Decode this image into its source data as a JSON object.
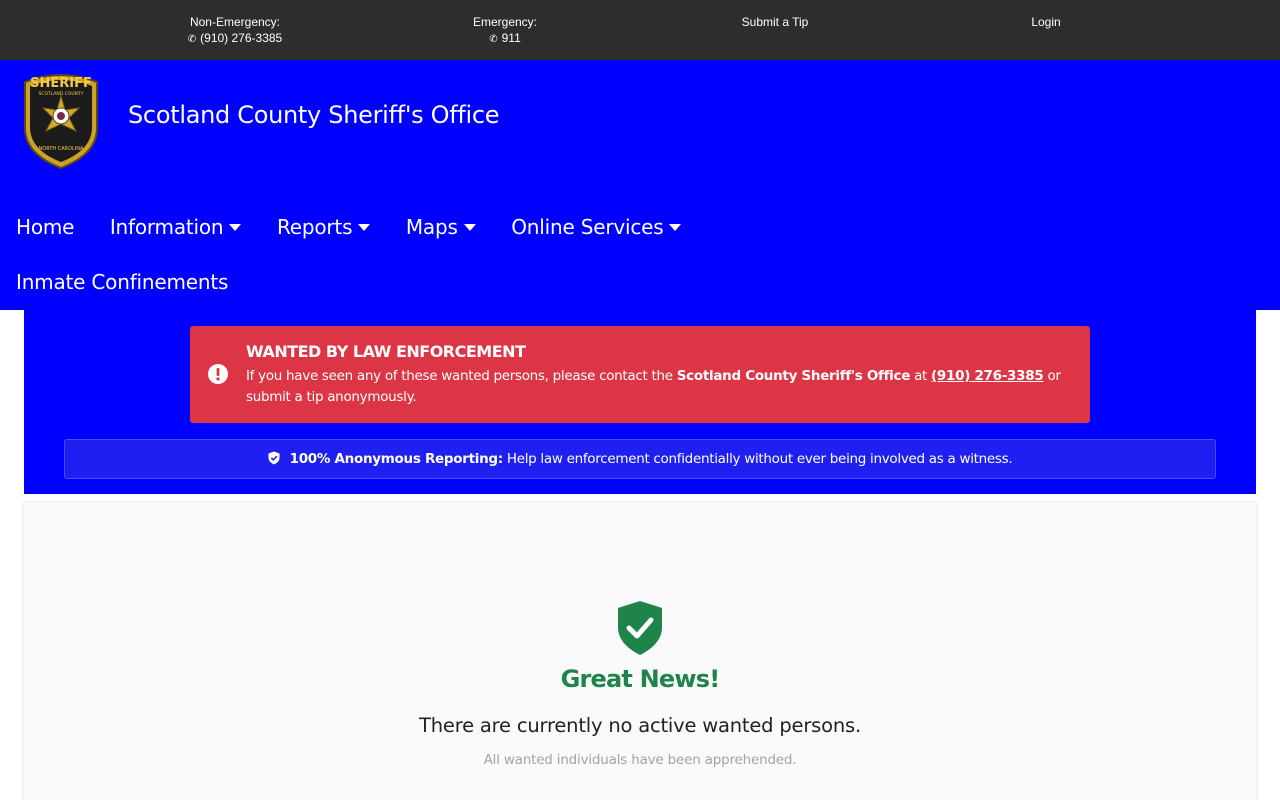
{
  "topbar": {
    "non_emergency_label": "Non-Emergency:",
    "non_emergency_phone": "(910) 276-3385",
    "emergency_label": "Emergency:",
    "emergency_phone": "911",
    "submit_tip": "Submit a Tip",
    "login": "Login"
  },
  "header": {
    "title": "Scotland County Sheriff's Office",
    "logo_text_top": "SHERIFF",
    "logo_text_county": "SCOTLAND COUNTY",
    "logo_text_state": "NORTH CAROLINA"
  },
  "nav": {
    "items": [
      {
        "label": "Home",
        "dropdown": false
      },
      {
        "label": "Information",
        "dropdown": true
      },
      {
        "label": "Reports",
        "dropdown": true
      },
      {
        "label": "Maps",
        "dropdown": true
      },
      {
        "label": "Online Services",
        "dropdown": true
      },
      {
        "label": "Inmate Confinements",
        "dropdown": false
      }
    ]
  },
  "alert": {
    "title": "WANTED BY LAW ENFORCEMENT",
    "body_prefix": "If you have seen any of these wanted persons, please contact the",
    "agency": "Scotland County Sheriff's Office",
    "at": "at",
    "phone": "(910) 276-3385",
    "body_suffix": "or submit a tip anonymously."
  },
  "anonymous": {
    "bold": "100% Anonymous Reporting:",
    "text": "Help law enforcement confidentially without ever being involved as a witness."
  },
  "status": {
    "headline": "Great News!",
    "message": "There are currently no active wanted persons.",
    "note": "All wanted individuals have been apprehended."
  },
  "colors": {
    "topbar": "#2d2d2d",
    "header": "#0000ff",
    "alert": "#dc3545",
    "success": "#1e8449"
  },
  "icons": [
    "phone-icon",
    "exclamation-circle-icon",
    "shield-check-icon",
    "chevron-down-icon",
    "sheriff-badge-logo"
  ]
}
